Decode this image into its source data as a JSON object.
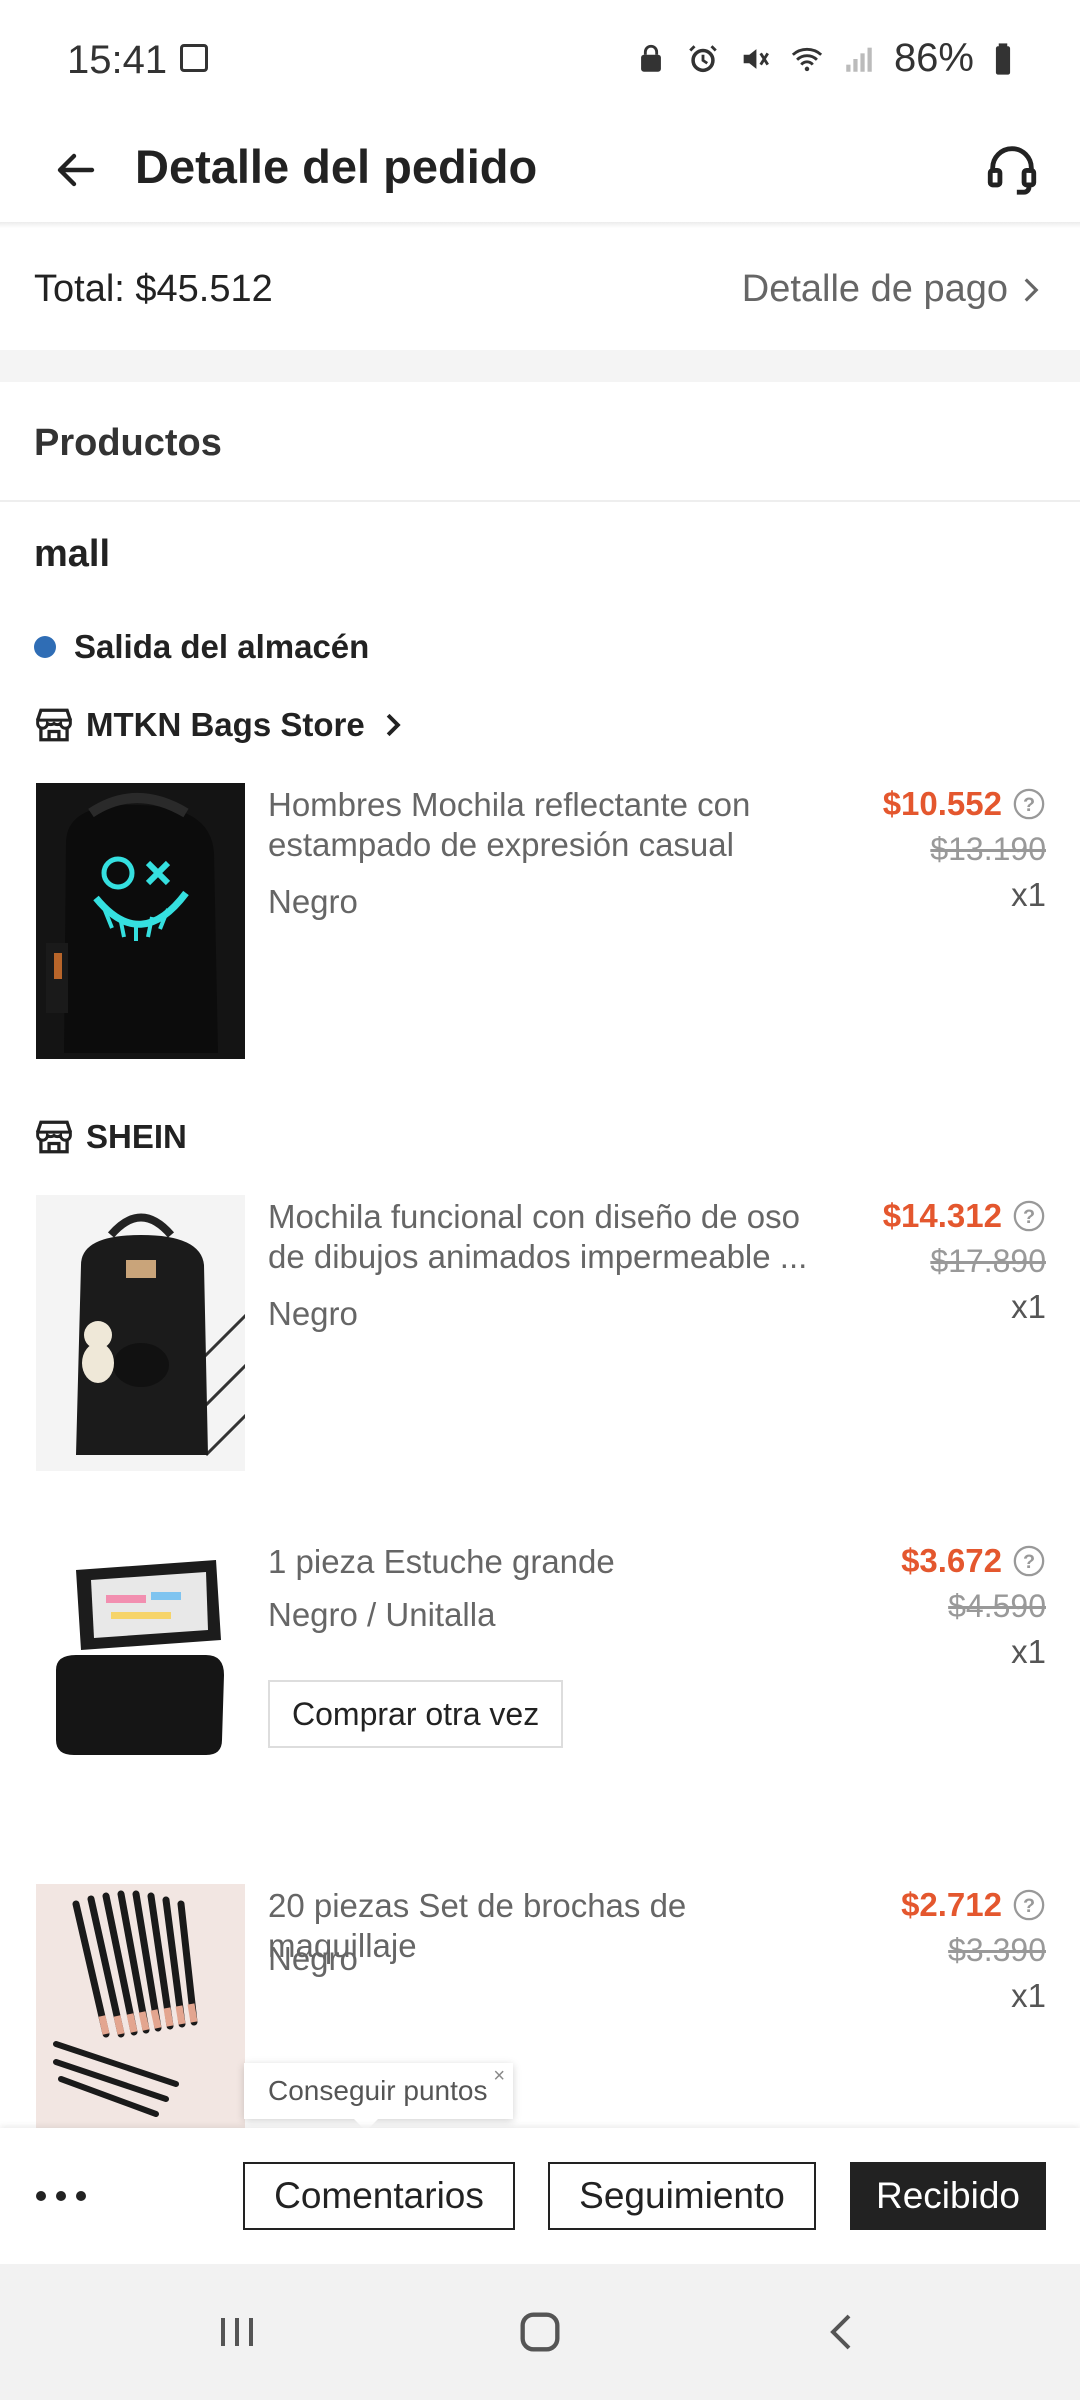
{
  "status_bar": {
    "time": "15:41",
    "battery": "86%"
  },
  "header": {
    "title": "Detalle del pedido"
  },
  "summary": {
    "total": "Total: $45.512",
    "payment_detail": "Detalle de pago"
  },
  "products_section": {
    "title": "Productos",
    "mall_label": "mall",
    "status": "Salida del almacén"
  },
  "stores": [
    {
      "name": "MTKN Bags Store",
      "items": [
        {
          "name": "Hombres Mochila reflectante con estampado de expresión casual",
          "variant": "Negro",
          "price": "$10.552",
          "old_price": "$13.190",
          "qty": "x1"
        }
      ]
    },
    {
      "name": "SHEIN",
      "items": [
        {
          "name": "Mochila funcional con diseño de oso de dibujos animados impermeable ...",
          "variant": "Negro",
          "price": "$14.312",
          "old_price": "$17.890",
          "qty": "x1"
        },
        {
          "name": "1 pieza Estuche grande",
          "variant": "Negro / Unitalla",
          "price": "$3.672",
          "old_price": "$4.590",
          "qty": "x1",
          "buy_again": "Comprar otra vez"
        },
        {
          "name": "20 piezas Set de brochas de maquillaje",
          "variant": "Negro",
          "price": "$2.712",
          "old_price": "$3.390",
          "qty": "x1"
        }
      ]
    }
  ],
  "tooltip": {
    "text": "Conseguir puntos",
    "close": "×"
  },
  "actions": {
    "comments": "Comentarios",
    "tracking": "Seguimiento",
    "received": "Recibido"
  },
  "colors": {
    "price": "#e4572e",
    "status_dot": "#2f6db5",
    "primary_button": "#222222"
  },
  "icons": [
    "back-arrow-icon",
    "headset-icon",
    "chevron-right-icon",
    "store-icon",
    "help-circle-icon",
    "more-dots-icon",
    "recents-icon",
    "home-icon",
    "nav-back-icon"
  ]
}
